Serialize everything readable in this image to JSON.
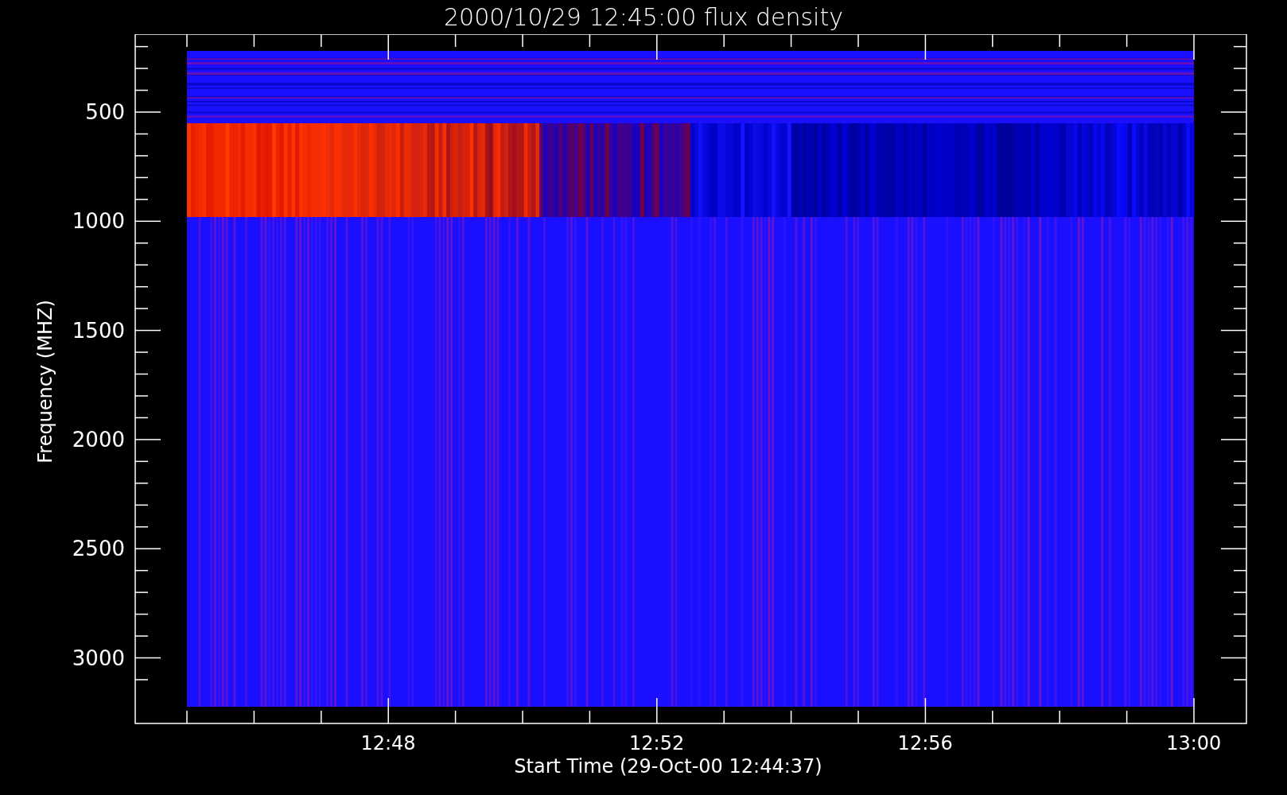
{
  "title": "2000/10/29 12:45:00 flux density",
  "y_axis": {
    "label": "Frequency (MHZ)",
    "tick_labels": [
      "500",
      "1000",
      "1500",
      "2000",
      "2500",
      "3000"
    ]
  },
  "x_axis": {
    "label": "Start Time (29-Oct-00 12:44:37)",
    "tick_labels": [
      "12:48",
      "12:52",
      "12:56",
      "13:00"
    ]
  }
}
